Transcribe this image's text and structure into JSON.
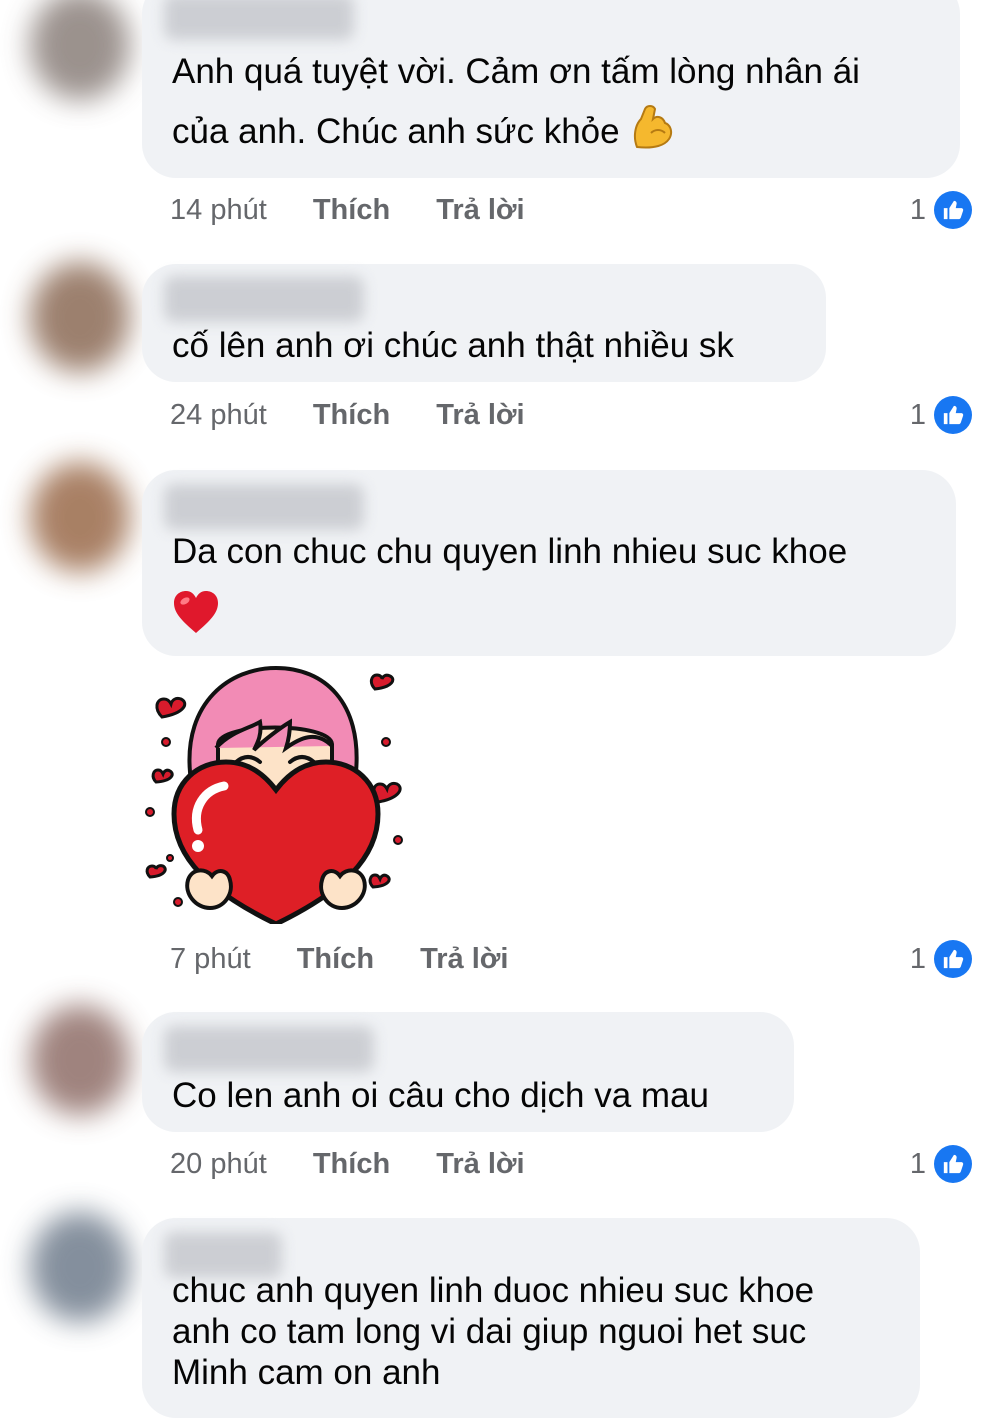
{
  "comments": [
    {
      "text": "Anh quá tuyệt vời. Cảm ơn tấm lòng nhân ái\ncủa anh. Chúc anh sức khỏe",
      "emoji": "flexed-biceps",
      "time": "14 phút",
      "like_label": "Thích",
      "reply_label": "Trả lời",
      "reactions": "1"
    },
    {
      "text": "cố lên anh ơi chúc anh thật nhiều sk",
      "time": "24 phút",
      "like_label": "Thích",
      "reply_label": "Trả lời",
      "reactions": "1"
    },
    {
      "text": "Da con chuc chu quyen linh nhieu suc khoe",
      "emoji": "red-heart",
      "sticker": "girl-hugging-heart",
      "time": "7 phút",
      "like_label": "Thích",
      "reply_label": "Trả lời",
      "reactions": "1"
    },
    {
      "text": "Co len anh oi câu cho dịch va mau",
      "time": "20 phút",
      "like_label": "Thích",
      "reply_label": "Trả lời",
      "reactions": "1"
    },
    {
      "text": "chuc anh quyen linh duoc nhieu suc khoe\nanh co tam long vi dai giup nguoi het suc\nMinh cam on anh"
    }
  ],
  "colors": {
    "bubble": "#f0f2f5",
    "meta_text": "#65676b",
    "like_blue": "#1877f2"
  }
}
